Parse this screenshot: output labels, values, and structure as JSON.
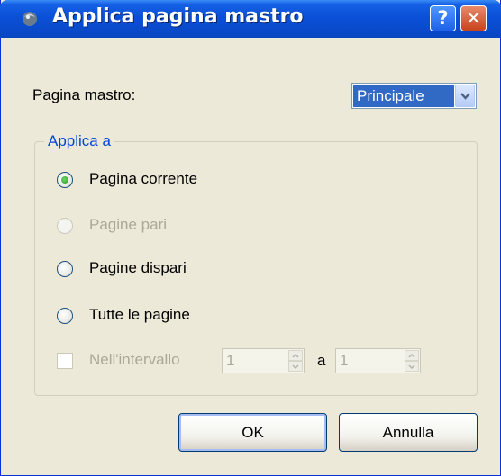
{
  "window": {
    "title": "Applica pagina mastro",
    "help_glyph": "?",
    "close_glyph": "✕",
    "title_icon": "app-icon"
  },
  "master_page": {
    "label": "Pagina mastro:",
    "selected": "Principale"
  },
  "apply_to": {
    "legend": "Applica a",
    "options": [
      {
        "label": "Pagina corrente",
        "checked": true,
        "enabled": true
      },
      {
        "label": "Pagine pari",
        "checked": false,
        "enabled": false
      },
      {
        "label": "Pagine dispari",
        "checked": false,
        "enabled": true
      },
      {
        "label": "Tutte le pagine",
        "checked": false,
        "enabled": true
      }
    ],
    "range": {
      "label": "Nell'intervallo",
      "checked": false,
      "enabled": false,
      "from": "1",
      "separator": "a",
      "to": "1"
    }
  },
  "buttons": {
    "ok": "OK",
    "cancel": "Annulla"
  },
  "colors": {
    "titlebar": "#0a50d8",
    "dialog_bg": "#ece9d8",
    "group_legend": "#0046d5",
    "selection": "#316ac5",
    "disabled_text": "#aca899"
  }
}
